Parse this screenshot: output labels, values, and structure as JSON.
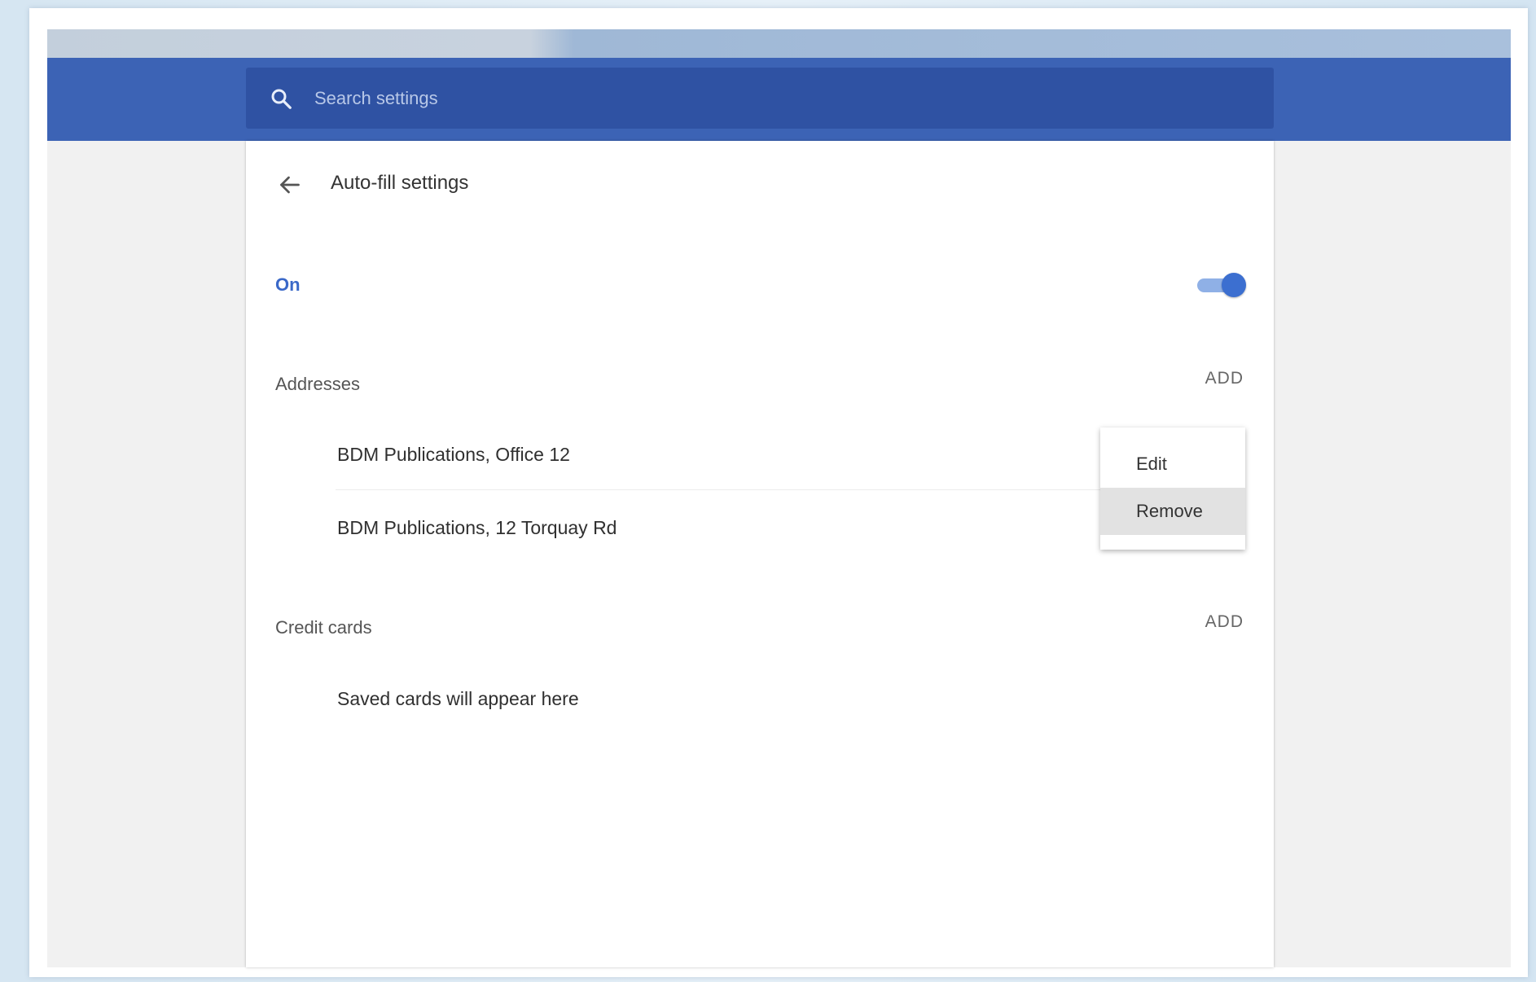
{
  "search": {
    "placeholder": "Search settings",
    "icon": "search-icon"
  },
  "page": {
    "title": "Auto-fill settings",
    "back_icon": "arrow-back-icon"
  },
  "autofill_toggle": {
    "label": "On",
    "state": true,
    "accent": "#3c6fd0"
  },
  "addresses": {
    "label": "Addresses",
    "add_label": "ADD",
    "items": [
      "BDM Publications, Office 12",
      "BDM Publications, 12 Torquay Rd"
    ]
  },
  "context_menu": {
    "items": [
      "Edit",
      "Remove"
    ],
    "highlighted": "Remove"
  },
  "credit_cards": {
    "label": "Credit cards",
    "add_label": "ADD",
    "empty_text": "Saved cards will appear here"
  },
  "colors": {
    "header": "#3c63b5",
    "search_box": "#2f52a3",
    "background": "#f1f1f1"
  }
}
